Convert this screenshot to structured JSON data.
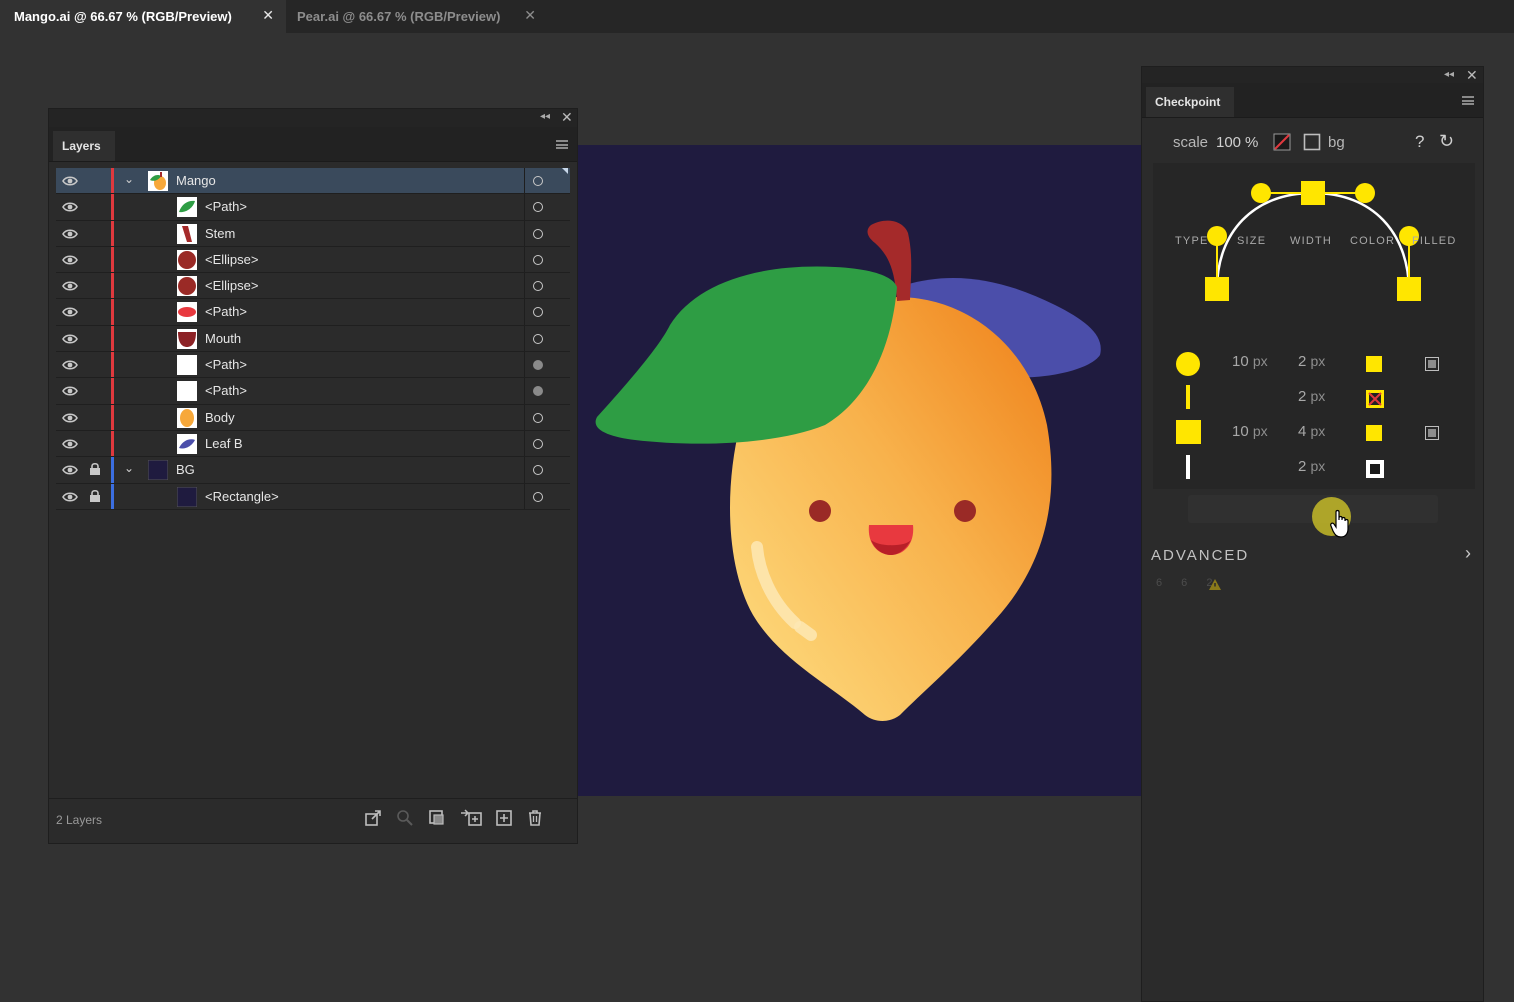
{
  "tabs": [
    {
      "title": "Mango.ai @ 66.67 % (RGB/Preview)",
      "close": "✕"
    },
    {
      "title": "Pear.ai @ 66.67 % (RGB/Preview)",
      "close": "✕"
    }
  ],
  "layers_panel": {
    "tab_label": "Layers",
    "collapse_glyph": "◂◂",
    "close_glyph": "✕",
    "footer_count": "2 Layers",
    "layers": [
      {
        "name": "Mango",
        "level": 0,
        "expanded": true,
        "selected": true,
        "locked": false,
        "color": "#e0393e",
        "thumb": "mango",
        "target_filled": false
      },
      {
        "name": "<Path>",
        "level": 1,
        "locked": false,
        "color": "#e0393e",
        "thumb": "leaf-green",
        "target_filled": false
      },
      {
        "name": "Stem",
        "level": 1,
        "locked": false,
        "color": "#e0393e",
        "thumb": "stem",
        "target_filled": false
      },
      {
        "name": "<Ellipse>",
        "level": 1,
        "locked": false,
        "color": "#e0393e",
        "thumb": "ellipse",
        "target_filled": false
      },
      {
        "name": "<Ellipse>",
        "level": 1,
        "locked": false,
        "color": "#e0393e",
        "thumb": "ellipse",
        "target_filled": false
      },
      {
        "name": "<Path>",
        "level": 1,
        "locked": false,
        "color": "#e0393e",
        "thumb": "red-path",
        "target_filled": false
      },
      {
        "name": "Mouth",
        "level": 1,
        "locked": false,
        "color": "#e0393e",
        "thumb": "mouth",
        "target_filled": false
      },
      {
        "name": "<Path>",
        "level": 1,
        "locked": false,
        "color": "#e0393e",
        "thumb": "white",
        "target_filled": true
      },
      {
        "name": "<Path>",
        "level": 1,
        "locked": false,
        "color": "#e0393e",
        "thumb": "white",
        "target_filled": true
      },
      {
        "name": "Body",
        "level": 1,
        "locked": false,
        "color": "#e0393e",
        "thumb": "body",
        "target_filled": false
      },
      {
        "name": "Leaf B",
        "level": 1,
        "locked": false,
        "color": "#e0393e",
        "thumb": "leaf-blue",
        "target_filled": false
      },
      {
        "name": "BG",
        "level": 0,
        "expanded": true,
        "selected": false,
        "locked": true,
        "color": "#3b6ee0",
        "thumb": "bg",
        "target_filled": false
      },
      {
        "name": "<Rectangle>",
        "level": 1,
        "locked": true,
        "color": "#3b6ee0",
        "thumb": "bg",
        "target_filled": false
      }
    ],
    "footer_icons": [
      "export-icon",
      "locate-object-icon",
      "make-clipping-mask-icon",
      "create-sublayer-icon",
      "new-layer-icon",
      "trash-icon"
    ]
  },
  "checkpoint_panel": {
    "tab_label": "Checkpoint",
    "collapse_glyph": "◂◂",
    "close_glyph": "✕",
    "scale_label": "scale",
    "scale_value": "100",
    "scale_unit": "%",
    "bg_label": "bg",
    "help_glyph": "?",
    "refresh_glyph": "↻",
    "columns": [
      "TYPE",
      "SIZE",
      "WIDTH",
      "COLOR",
      "FILLED"
    ],
    "rows": [
      {
        "type": "circle-point",
        "size": "10",
        "size_unit": "px",
        "width": "2",
        "width_unit": "px",
        "color": "yellow",
        "filled": true
      },
      {
        "type": "line-handle",
        "size": "",
        "size_unit": "",
        "width": "2",
        "width_unit": "px",
        "color": "yellow-crossed",
        "filled": false
      },
      {
        "type": "square-point",
        "size": "10",
        "size_unit": "px",
        "width": "4",
        "width_unit": "px",
        "color": "yellow",
        "filled": true
      },
      {
        "type": "line-path",
        "size": "",
        "size_unit": "",
        "width": "2",
        "width_unit": "px",
        "color": "white",
        "filled": false
      }
    ],
    "advanced_label": "ADVANCED",
    "advanced_chevron": "›",
    "faint_numbers": "6 6 2"
  },
  "colors": {
    "accent_yellow": "#ffe600",
    "artboard_bg": "#1f1b3f",
    "layer_red": "#e0393e",
    "layer_blue": "#3b6ee0",
    "selection": "#3a4a5c"
  }
}
